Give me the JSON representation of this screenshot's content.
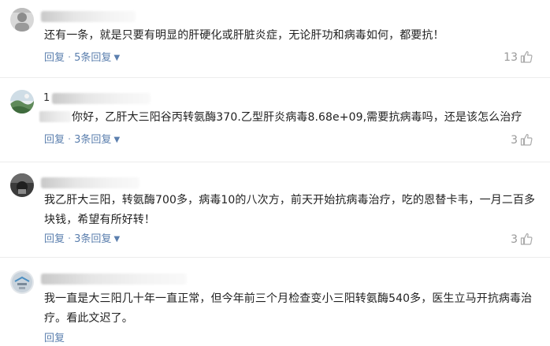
{
  "comments": [
    {
      "name_initial": "",
      "text_lines": [
        "还有一条，就是只要有明显的肝硬化或肝脏炎症，无论肝功和病毒如何，都要抗！"
      ],
      "reply_label": "回复",
      "replies_label": "5条回复",
      "likes": "13"
    },
    {
      "name_initial": "1",
      "text_lines": [
        "你好，乙肝大三阳谷丙转氨酶370.乙型肝炎病毒8.68e+09,需要抗病毒吗，还是该怎么治疗"
      ],
      "reply_label": "回复",
      "replies_label": "3条回复",
      "likes": "3"
    },
    {
      "name_initial": "",
      "text_lines": [
        "我乙肝大三阳，转氨酶700多，病毒10的八次方，前天开始抗病毒治疗，吃的恩替卡韦，一月二百多",
        "块钱，希望有所好转！"
      ],
      "reply_label": "回复",
      "replies_label": "3条回复",
      "likes": "3"
    },
    {
      "name_initial": "",
      "text_lines": [
        "我一直是大三阳几十年一直正常，但今年前三个月检查变小三阳转氨酶540多，医生立马开抗病毒治",
        "疗。看此文迟了。"
      ],
      "reply_label": "回复",
      "replies_label": "",
      "likes": ""
    }
  ],
  "icons": {
    "like": "thumb-up-icon",
    "expand": "caret-down-icon"
  },
  "colors": {
    "action_link": "#5b7fae",
    "like_gray": "#999999",
    "text": "#222222",
    "divider": "#ececec"
  }
}
